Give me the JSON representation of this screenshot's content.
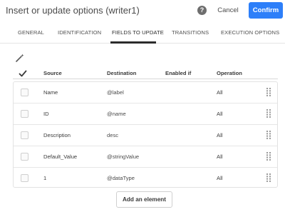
{
  "dialog": {
    "title": "Insert or update options (writer1)",
    "help_icon": "question-circle-icon",
    "cancel_label": "Cancel",
    "confirm_label": "Confirm",
    "accent_color": "#2d7ff9"
  },
  "tabs": [
    {
      "label": "GENERAL",
      "active": false
    },
    {
      "label": "IDENTIFICATION",
      "active": false
    },
    {
      "label": "FIELDS TO UPDATE",
      "active": true
    },
    {
      "label": "TRANSITIONS",
      "active": false
    },
    {
      "label": "EXECUTION OPTIONS",
      "active": false
    }
  ],
  "toolbar": {
    "icon": "magic-wand-icon"
  },
  "table": {
    "columns": {
      "select_all_icon": "checkmark-icon",
      "source": "Source",
      "destination": "Destination",
      "enabled_if": "Enabled if",
      "operation": "Operation"
    },
    "rows": [
      {
        "source": "Name",
        "destination": "@label",
        "enabled_if": "",
        "operation": "All",
        "checked": false
      },
      {
        "source": "ID",
        "destination": "@name",
        "enabled_if": "",
        "operation": "All",
        "checked": false
      },
      {
        "source": "Description",
        "destination": "desc",
        "enabled_if": "",
        "operation": "All",
        "checked": false
      },
      {
        "source": "Default_Value",
        "destination": "@stringValue",
        "enabled_if": "",
        "operation": "All",
        "checked": false
      },
      {
        "source": "1",
        "destination": "@dataType",
        "enabled_if": "",
        "operation": "All",
        "checked": false
      }
    ]
  },
  "actions": {
    "add_label": "Add an element"
  }
}
